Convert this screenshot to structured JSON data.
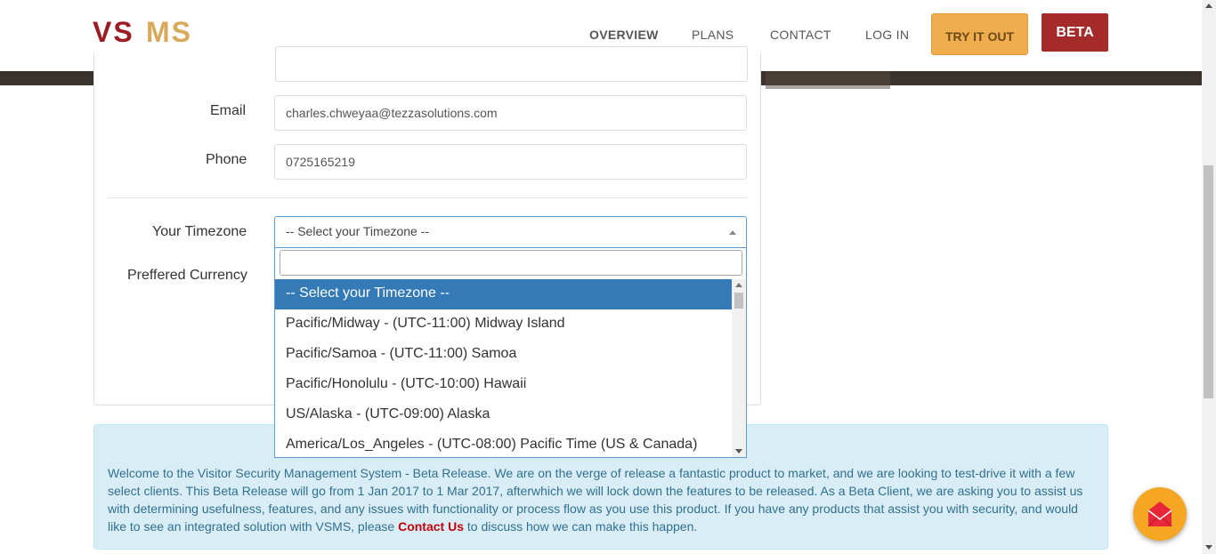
{
  "brand": {
    "logo_text": "VSMS",
    "logo_dark": "#9b1c23",
    "logo_gold": "#d9a95b"
  },
  "nav": {
    "overview": "OVERVIEW",
    "plans": "PLANS",
    "contact": "CONTACT",
    "login": "LOG IN",
    "try_it_out": "TRY IT OUT",
    "beta": "BETA"
  },
  "form": {
    "email_label": "Email",
    "email_value": "charles.chweyaa@tezzasolutions.com",
    "phone_label": "Phone",
    "phone_value": "0725165219",
    "timezone_label": "Your Timezone",
    "timezone_selected": "-- Select your Timezone --",
    "currency_label": "Preffered Currency"
  },
  "timezone_dropdown": {
    "search_value": "",
    "options": [
      "-- Select your Timezone --",
      "Pacific/Midway - (UTC-11:00) Midway Island",
      "Pacific/Samoa - (UTC-11:00) Samoa",
      "Pacific/Honolulu - (UTC-10:00) Hawaii",
      "US/Alaska - (UTC-09:00) Alaska",
      "America/Los_Angeles - (UTC-08:00) Pacific Time (US & Canada)"
    ]
  },
  "beta_notice": {
    "text_before_link": "Welcome to the Visitor Security Management System - Beta Release. We are on the verge of release a fantastic product to market, and we are looking to test-drive it with a few select clients. This Beta Release will go from 1 Jan 2017 to 1 Mar 2017, afterwhich we will lock down the features to be released. As a Beta Client, we are asking you to assist us with determining usefulness, features, and any issues with functionality or process flow as you use this product. If you have any products that assist you with security, and would like to see an integrated solution with VSMS, please ",
    "link_text": "Contact Us",
    "text_after_link": " to discuss how we can make this happen."
  },
  "fab": {
    "icon": "envelope-icon"
  }
}
